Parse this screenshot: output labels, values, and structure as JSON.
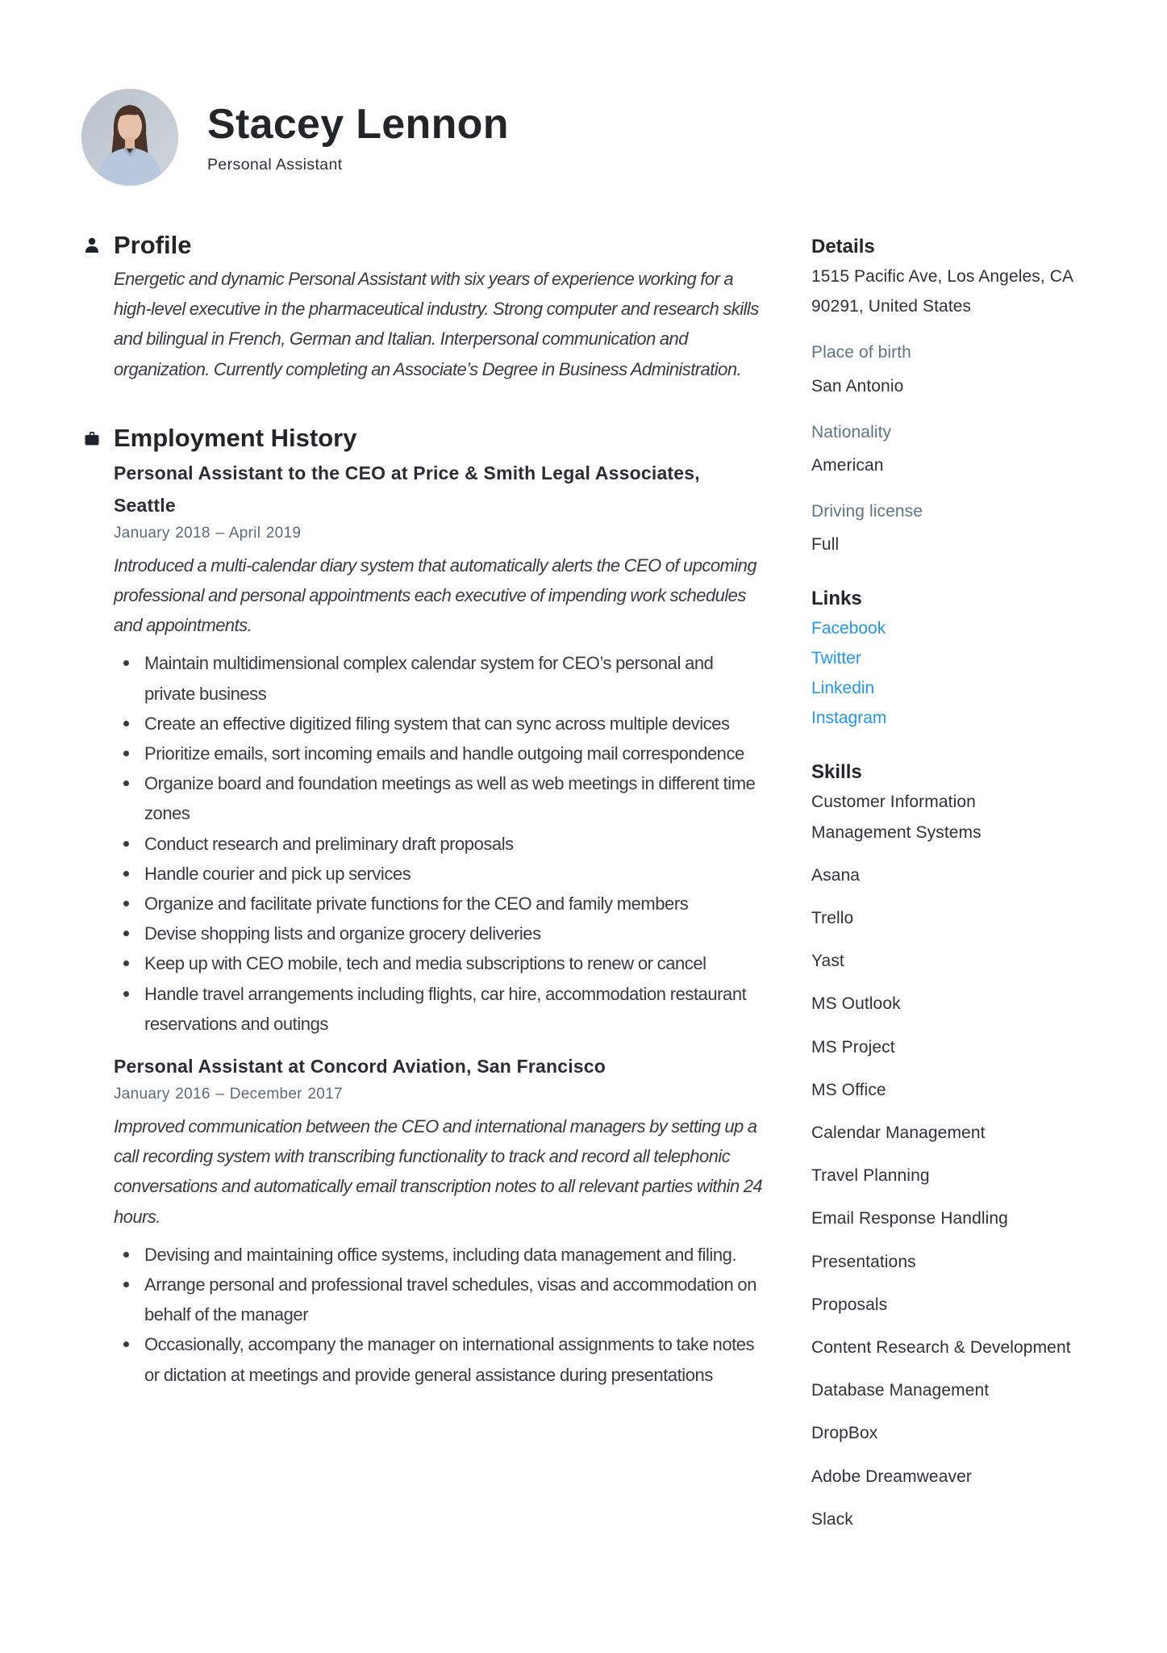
{
  "header": {
    "name": "Stacey Lennon",
    "job_title": "Personal Assistant",
    "avatar_icon": "profile-photo"
  },
  "profile": {
    "heading": "Profile",
    "icon": "person-icon",
    "summary": "Energetic and dynamic Personal Assistant with six years of experience working for a high-level executive in the pharmaceutical industry. Strong computer and research skills and bilingual in French, German and Italian. Interpersonal communication and organization. Currently completing an Associate’s Degree in Business Administration."
  },
  "employment": {
    "heading": "Employment History",
    "icon": "briefcase-icon",
    "jobs": [
      {
        "title": "Personal Assistant to the CEO at Price & Smith Legal Associates, Seattle",
        "dates": "January 2018  –  April 2019",
        "description": "Introduced a multi-calendar diary system that automatically alerts the CEO of upcoming professional and personal appointments each executive of impending work schedules and appointments.",
        "bullets": [
          "Maintain multidimensional complex calendar system for CEO’s personal and private business",
          "Create an effective digitized filing system that can sync across multiple devices",
          "Prioritize emails, sort incoming emails and handle outgoing mail correspondence",
          "Organize board and foundation meetings as well as web meetings in different time zones",
          "Conduct research and preliminary draft proposals",
          "Handle courier and pick up services",
          "Organize and facilitate private functions for the CEO and family members",
          "Devise shopping lists and organize grocery deliveries",
          "Keep up with CEO mobile, tech and media subscriptions to renew or cancel",
          "Handle travel arrangements including flights, car hire, accommodation restaurant reservations and outings"
        ]
      },
      {
        "title": "Personal Assistant at Concord Aviation, San Francisco",
        "dates": "January 2016  –  December 2017",
        "description": "Improved communication between the CEO and international managers by setting up a call recording system with transcribing functionality to track and record all telephonic conversations and automatically email transcription notes to all relevant parties within 24 hours.",
        "bullets": [
          "Devising and maintaining office systems, including data management and filing.",
          "Arrange personal and professional travel schedules, visas and accommodation on behalf of the manager",
          "Occasionally, accompany the manager  on international assignments to take notes or dictation at meetings and provide general assistance during presentations"
        ]
      }
    ]
  },
  "details": {
    "heading": "Details",
    "address_line1": "1515 Pacific Ave, Los Angeles, CA",
    "address_line2": "90291, United States",
    "fields": [
      {
        "label": "Place of birth",
        "value": "San Antonio"
      },
      {
        "label": "Nationality",
        "value": "American"
      },
      {
        "label": "Driving license",
        "value": "Full"
      }
    ]
  },
  "links": {
    "heading": "Links",
    "color": "#2196f3",
    "items": [
      "Facebook",
      "Twitter",
      "Linkedin",
      "Instagram"
    ]
  },
  "skills": {
    "heading": "Skills",
    "items": [
      "Customer Information Management Systems",
      "Asana",
      "Trello",
      "Yast",
      "MS Outlook",
      "MS Project",
      "MS Office",
      "Calendar Management",
      "Travel Planning",
      "Email Response Handling",
      "Presentations",
      "Proposals",
      "Content Research & Development",
      "Database Management",
      "DropBox",
      "Adobe Dreamweaver",
      "Slack"
    ]
  }
}
